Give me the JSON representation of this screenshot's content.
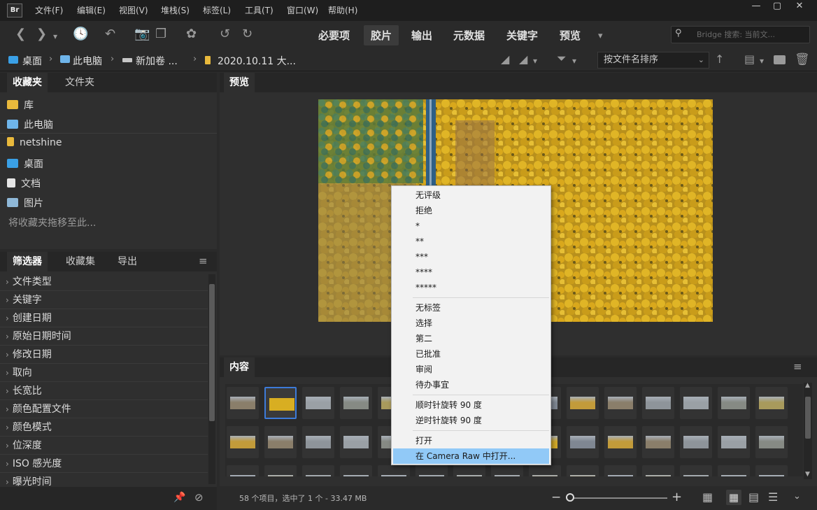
{
  "app": {
    "logo": "Br"
  },
  "menubar": [
    "文件(F)",
    "编辑(E)",
    "视图(V)",
    "堆栈(S)",
    "标签(L)",
    "工具(T)",
    "窗口(W)",
    "帮助(H)"
  ],
  "workspaces": [
    "必要项",
    "胶片",
    "输出",
    "元数据",
    "关键字",
    "预览"
  ],
  "active_workspace": "胶片",
  "search": {
    "placeholder": "Bridge 搜索: 当前文..."
  },
  "breadcrumb": [
    "桌面",
    "此电脑",
    "新加卷 ...",
    "2020.10.11 大..."
  ],
  "sort": {
    "selected": "按文件名排序"
  },
  "favorites_panel": {
    "tabs": [
      "收藏夹",
      "文件夹"
    ],
    "items": [
      "库",
      "此电脑",
      "netshine",
      "桌面",
      "文档",
      "图片"
    ],
    "hint": "将收藏夹拖移至此..."
  },
  "filter_panel": {
    "tabs": [
      "筛选器",
      "收藏集",
      "导出"
    ],
    "rows": [
      "文件类型",
      "关键字",
      "创建日期",
      "原始日期时间",
      "修改日期",
      "取向",
      "长宽比",
      "颜色配置文件",
      "颜色模式",
      "位深度",
      "ISO 感光度",
      "曝光时间"
    ]
  },
  "preview_panel": {
    "tab": "预览"
  },
  "content_panel": {
    "tab": "内容"
  },
  "status": {
    "text": "58 个项目，选中了 1 个 - 33.47 MB"
  },
  "context_menu": {
    "items": [
      "无评级",
      "拒绝",
      "*",
      "**",
      "***",
      "****",
      "*****",
      "无标签",
      "选择",
      "第二",
      "已批准",
      "审阅",
      "待办事宜",
      "顺时针旋转 90 度",
      "逆时针旋转 90 度",
      "打开",
      "在 Camera Raw 中打开..."
    ],
    "highlighted": "在 Camera Raw 中打开..."
  },
  "colors": {
    "bg": "#2a2a2a",
    "panel": "#2f2f2f",
    "accent": "#91c9f7",
    "selection_border": "#3d7bd9"
  }
}
